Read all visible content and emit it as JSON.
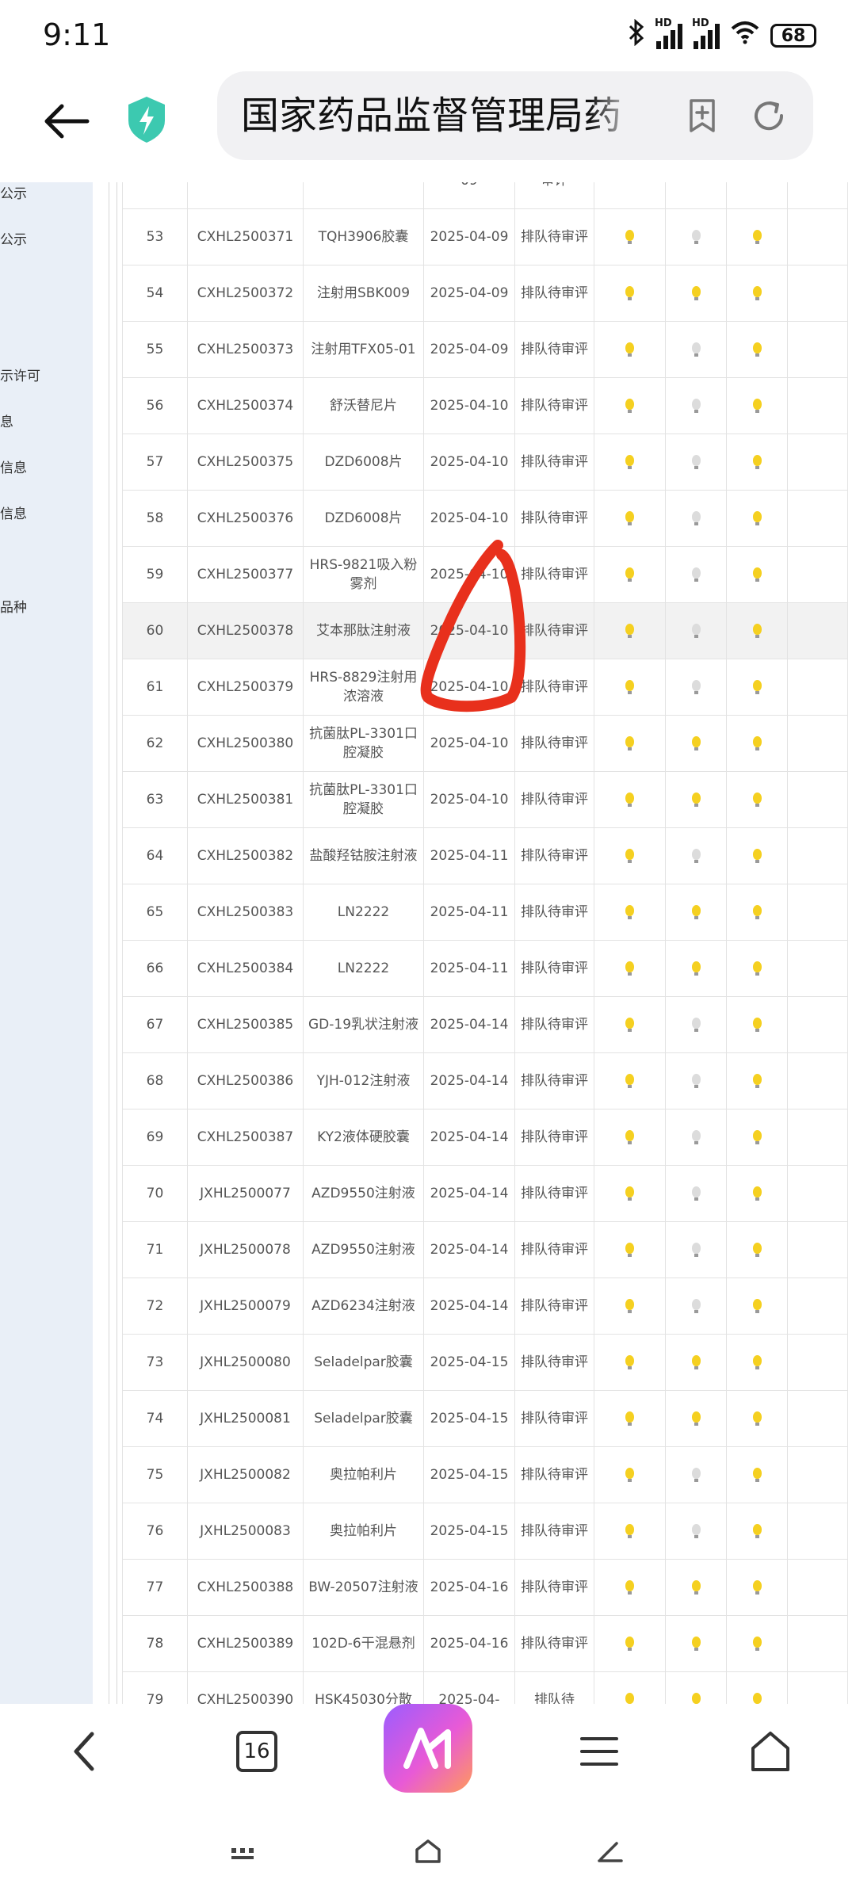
{
  "status_bar": {
    "time": "9:11",
    "battery": "68",
    "signal_label": "HD"
  },
  "browser": {
    "address_text": "国家药品监督管理局药",
    "tab_count": "16"
  },
  "sidebar": {
    "items": [
      "公示",
      "公示",
      "示许可",
      "息",
      "信息",
      "信息",
      "品种"
    ]
  },
  "table": {
    "rows": [
      {
        "no": "",
        "code": "",
        "name": "",
        "date": "09",
        "status": "审评",
        "lights": [
          null,
          null,
          null
        ]
      },
      {
        "no": "53",
        "code": "CXHL2500371",
        "name": "TQH3906胶囊",
        "date": "2025-04-09",
        "status": "排队待审评",
        "lights": [
          true,
          false,
          true
        ]
      },
      {
        "no": "54",
        "code": "CXHL2500372",
        "name": "注射用SBK009",
        "date": "2025-04-09",
        "status": "排队待审评",
        "lights": [
          true,
          true,
          true
        ]
      },
      {
        "no": "55",
        "code": "CXHL2500373",
        "name": "注射用TFX05-01",
        "date": "2025-04-09",
        "status": "排队待审评",
        "lights": [
          true,
          false,
          true
        ]
      },
      {
        "no": "56",
        "code": "CXHL2500374",
        "name": "舒沃替尼片",
        "date": "2025-04-10",
        "status": "排队待审评",
        "lights": [
          true,
          false,
          true
        ]
      },
      {
        "no": "57",
        "code": "CXHL2500375",
        "name": "DZD6008片",
        "date": "2025-04-10",
        "status": "排队待审评",
        "lights": [
          true,
          false,
          true
        ]
      },
      {
        "no": "58",
        "code": "CXHL2500376",
        "name": "DZD6008片",
        "date": "2025-04-10",
        "status": "排队待审评",
        "lights": [
          true,
          false,
          true
        ]
      },
      {
        "no": "59",
        "code": "CXHL2500377",
        "name": "HRS-9821吸入粉雾剂",
        "date": "2025-04-10",
        "status": "排队待审评",
        "lights": [
          true,
          false,
          true
        ]
      },
      {
        "no": "60",
        "code": "CXHL2500378",
        "name": "艾本那肽注射液",
        "date": "2025-04-10",
        "status": "排队待审评",
        "lights": [
          true,
          false,
          true
        ]
      },
      {
        "no": "61",
        "code": "CXHL2500379",
        "name": "HRS-8829注射用浓溶液",
        "date": "2025-04-10",
        "status": "排队待审评",
        "lights": [
          true,
          false,
          true
        ]
      },
      {
        "no": "62",
        "code": "CXHL2500380",
        "name": "抗菌肽PL-3301口腔凝胶",
        "date": "2025-04-10",
        "status": "排队待审评",
        "lights": [
          true,
          true,
          true
        ]
      },
      {
        "no": "63",
        "code": "CXHL2500381",
        "name": "抗菌肽PL-3301口腔凝胶",
        "date": "2025-04-10",
        "status": "排队待审评",
        "lights": [
          true,
          true,
          true
        ]
      },
      {
        "no": "64",
        "code": "CXHL2500382",
        "name": "盐酸羟钴胺注射液",
        "date": "2025-04-11",
        "status": "排队待审评",
        "lights": [
          true,
          false,
          true
        ]
      },
      {
        "no": "65",
        "code": "CXHL2500383",
        "name": "LN2222",
        "date": "2025-04-11",
        "status": "排队待审评",
        "lights": [
          true,
          true,
          true
        ]
      },
      {
        "no": "66",
        "code": "CXHL2500384",
        "name": "LN2222",
        "date": "2025-04-11",
        "status": "排队待审评",
        "lights": [
          true,
          true,
          true
        ]
      },
      {
        "no": "67",
        "code": "CXHL2500385",
        "name": "GD-19乳状注射液",
        "date": "2025-04-14",
        "status": "排队待审评",
        "lights": [
          true,
          false,
          true
        ]
      },
      {
        "no": "68",
        "code": "CXHL2500386",
        "name": "YJH-012注射液",
        "date": "2025-04-14",
        "status": "排队待审评",
        "lights": [
          true,
          false,
          true
        ]
      },
      {
        "no": "69",
        "code": "CXHL2500387",
        "name": "KY2液体硬胶囊",
        "date": "2025-04-14",
        "status": "排队待审评",
        "lights": [
          true,
          false,
          true
        ]
      },
      {
        "no": "70",
        "code": "JXHL2500077",
        "name": "AZD9550注射液",
        "date": "2025-04-14",
        "status": "排队待审评",
        "lights": [
          true,
          false,
          true
        ]
      },
      {
        "no": "71",
        "code": "JXHL2500078",
        "name": "AZD9550注射液",
        "date": "2025-04-14",
        "status": "排队待审评",
        "lights": [
          true,
          false,
          true
        ]
      },
      {
        "no": "72",
        "code": "JXHL2500079",
        "name": "AZD6234注射液",
        "date": "2025-04-14",
        "status": "排队待审评",
        "lights": [
          true,
          false,
          true
        ]
      },
      {
        "no": "73",
        "code": "JXHL2500080",
        "name": "Seladelpar胶囊",
        "date": "2025-04-15",
        "status": "排队待审评",
        "lights": [
          true,
          true,
          true
        ]
      },
      {
        "no": "74",
        "code": "JXHL2500081",
        "name": "Seladelpar胶囊",
        "date": "2025-04-15",
        "status": "排队待审评",
        "lights": [
          true,
          true,
          true
        ]
      },
      {
        "no": "75",
        "code": "JXHL2500082",
        "name": "奥拉帕利片",
        "date": "2025-04-15",
        "status": "排队待审评",
        "lights": [
          true,
          false,
          true
        ]
      },
      {
        "no": "76",
        "code": "JXHL2500083",
        "name": "奥拉帕利片",
        "date": "2025-04-15",
        "status": "排队待审评",
        "lights": [
          true,
          false,
          true
        ]
      },
      {
        "no": "77",
        "code": "CXHL2500388",
        "name": "BW-20507注射液",
        "date": "2025-04-16",
        "status": "排队待审评",
        "lights": [
          true,
          true,
          true
        ]
      },
      {
        "no": "78",
        "code": "CXHL2500389",
        "name": "102D-6干混悬剂",
        "date": "2025-04-16",
        "status": "排队待审评",
        "lights": [
          true,
          true,
          true
        ]
      },
      {
        "no": "79",
        "code": "CXHL2500390",
        "name": "HSK45030分散",
        "date": "2025-04-",
        "status": "排队待",
        "lights": [
          true,
          true,
          true
        ]
      }
    ],
    "highlighted_row_no": "60"
  },
  "colors": {
    "bulb_on": "#f5d020",
    "bulb_off": "#dcdcdc",
    "sidebar_bg": "#e9eff7",
    "annotation_red": "#e8301c"
  }
}
